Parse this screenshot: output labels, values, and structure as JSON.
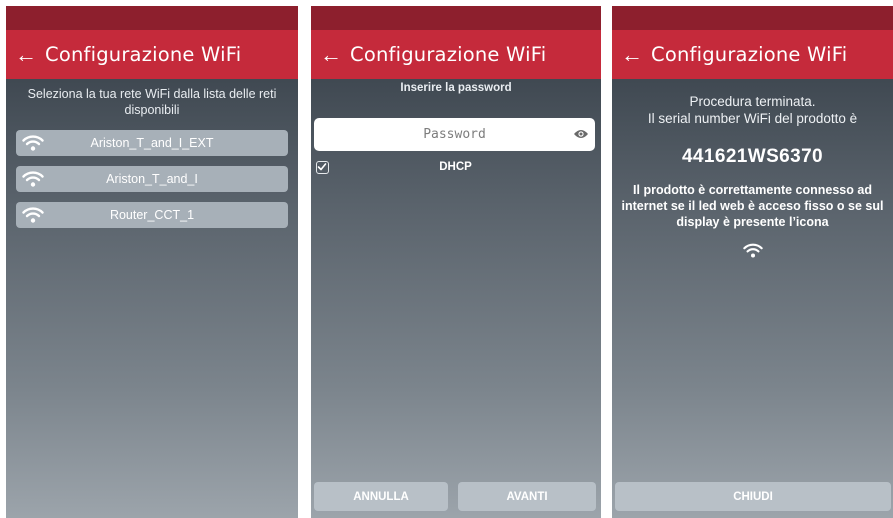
{
  "screens": [
    {
      "app_title": "Configurazione WiFi",
      "back_icon": "arrow-left-icon",
      "instructions": "Seleziona la tua rete WiFi dalla lista delle reti disponibili",
      "networks": [
        {
          "ssid": "Ariston_T_and_I_EXT",
          "icon": "wifi-icon"
        },
        {
          "ssid": "Ariston_T_and_I",
          "icon": "wifi-icon"
        },
        {
          "ssid": "Router_CCT_1",
          "icon": "wifi-icon"
        }
      ]
    },
    {
      "app_title": "Configurazione WiFi",
      "back_icon": "arrow-left-icon",
      "password_label": "Inserire la password",
      "password_placeholder": "Password",
      "password_value": "",
      "show_password_icon": "eye-icon",
      "dhcp_label": "DHCP",
      "dhcp_checked": true,
      "cancel_label": "ANNULLA",
      "next_label": "AVANTI"
    },
    {
      "app_title": "Configurazione WiFi",
      "back_icon": "arrow-left-icon",
      "done_title": "Procedura terminata.",
      "done_subtitle": "Il serial number WiFi del prodotto è",
      "serial_number": "441621WS6370",
      "connected_message": "Il prodotto è correttamente connesso ad internet se il led web è acceso fisso o se sul display è presente l’icona",
      "status_icon": "wifi-icon",
      "close_label": "CHIUDI"
    }
  ],
  "colors": {
    "app_bar": "#c52a3b",
    "status_bar": "#8d1f2d",
    "list_item": "#a7b0b8",
    "button": "#b8c0c7"
  }
}
